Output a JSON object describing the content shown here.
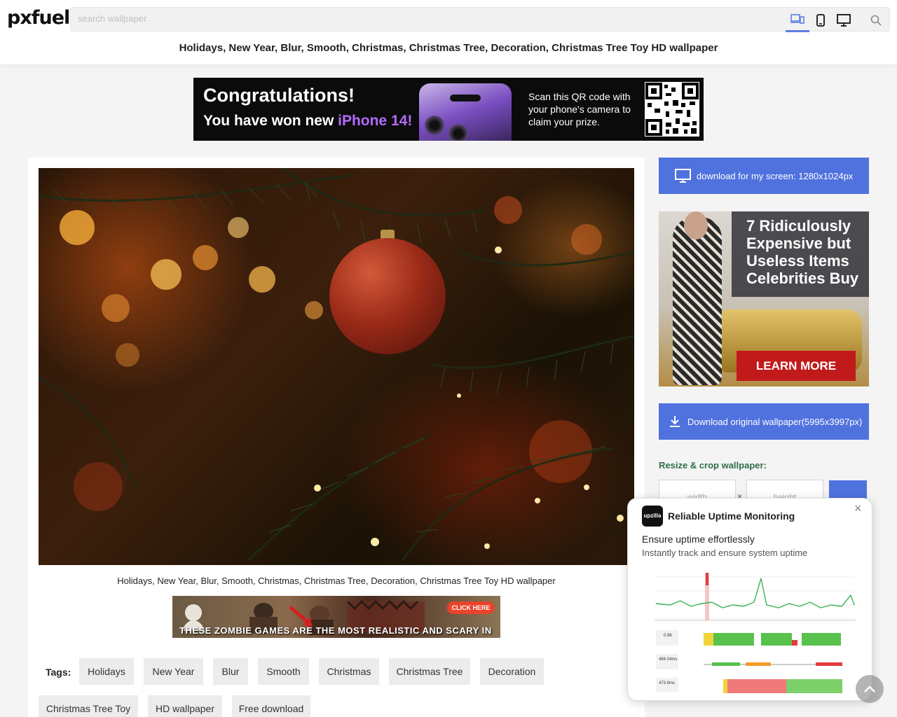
{
  "header": {
    "logo": "pxfuel",
    "search_placeholder": "search wallpaper",
    "title": "Holidays, New Year, Blur, Smooth, Christmas, Christmas Tree, Decoration, Christmas Tree Toy HD wallpaper"
  },
  "top_ad": {
    "line1": "Congratulations!",
    "line2_prefix": "You have won new ",
    "line2_highlight": "iPhone 14!",
    "scan_text": "Scan this QR code with your phone's camera to claim your prize."
  },
  "main": {
    "caption": "Holidays, New Year, Blur, Smooth, Christmas, Christmas Tree, Decoration, Christmas Tree Toy HD wallpaper",
    "zombie_ad": {
      "text": "THESE ZOMBIE GAMES ARE THE MOST REALISTIC AND SCARY IN YOUR LIFE",
      "cta": "CLICK HERE"
    },
    "tags_label": "Tags:",
    "tags": [
      "Holidays",
      "New Year",
      "Blur",
      "Smooth",
      "Christmas",
      "Christmas Tree",
      "Decoration",
      "Christmas Tree Toy",
      "HD wallpaper",
      "Free download"
    ]
  },
  "sidebar": {
    "download_screen": "download for my screen: 1280x1024px",
    "celeb_ad": {
      "headline": "7 Ridiculously Expensive but Useless Items Celebrities Buy",
      "cta": "LEARN MORE"
    },
    "download_original": "Download original wallpaper(5995x3997px)",
    "resize_label": "Resize & crop wallpaper:",
    "width_placeholder": "width",
    "height_placeholder": "height",
    "times": "×"
  },
  "popup": {
    "logo": "upzilla",
    "title": "Reliable Uptime Monitoring",
    "headline": "Ensure uptime effortlessly",
    "subtext": "Instantly track and ensure system uptime",
    "close": "×",
    "metric1": "0.96",
    "metric2": "484.04ms",
    "metric3": "473.9ms"
  },
  "colors": {
    "accent_blue": "#5072de",
    "resize_green": "#2f6d4a",
    "ad_red": "#c11a1a"
  }
}
